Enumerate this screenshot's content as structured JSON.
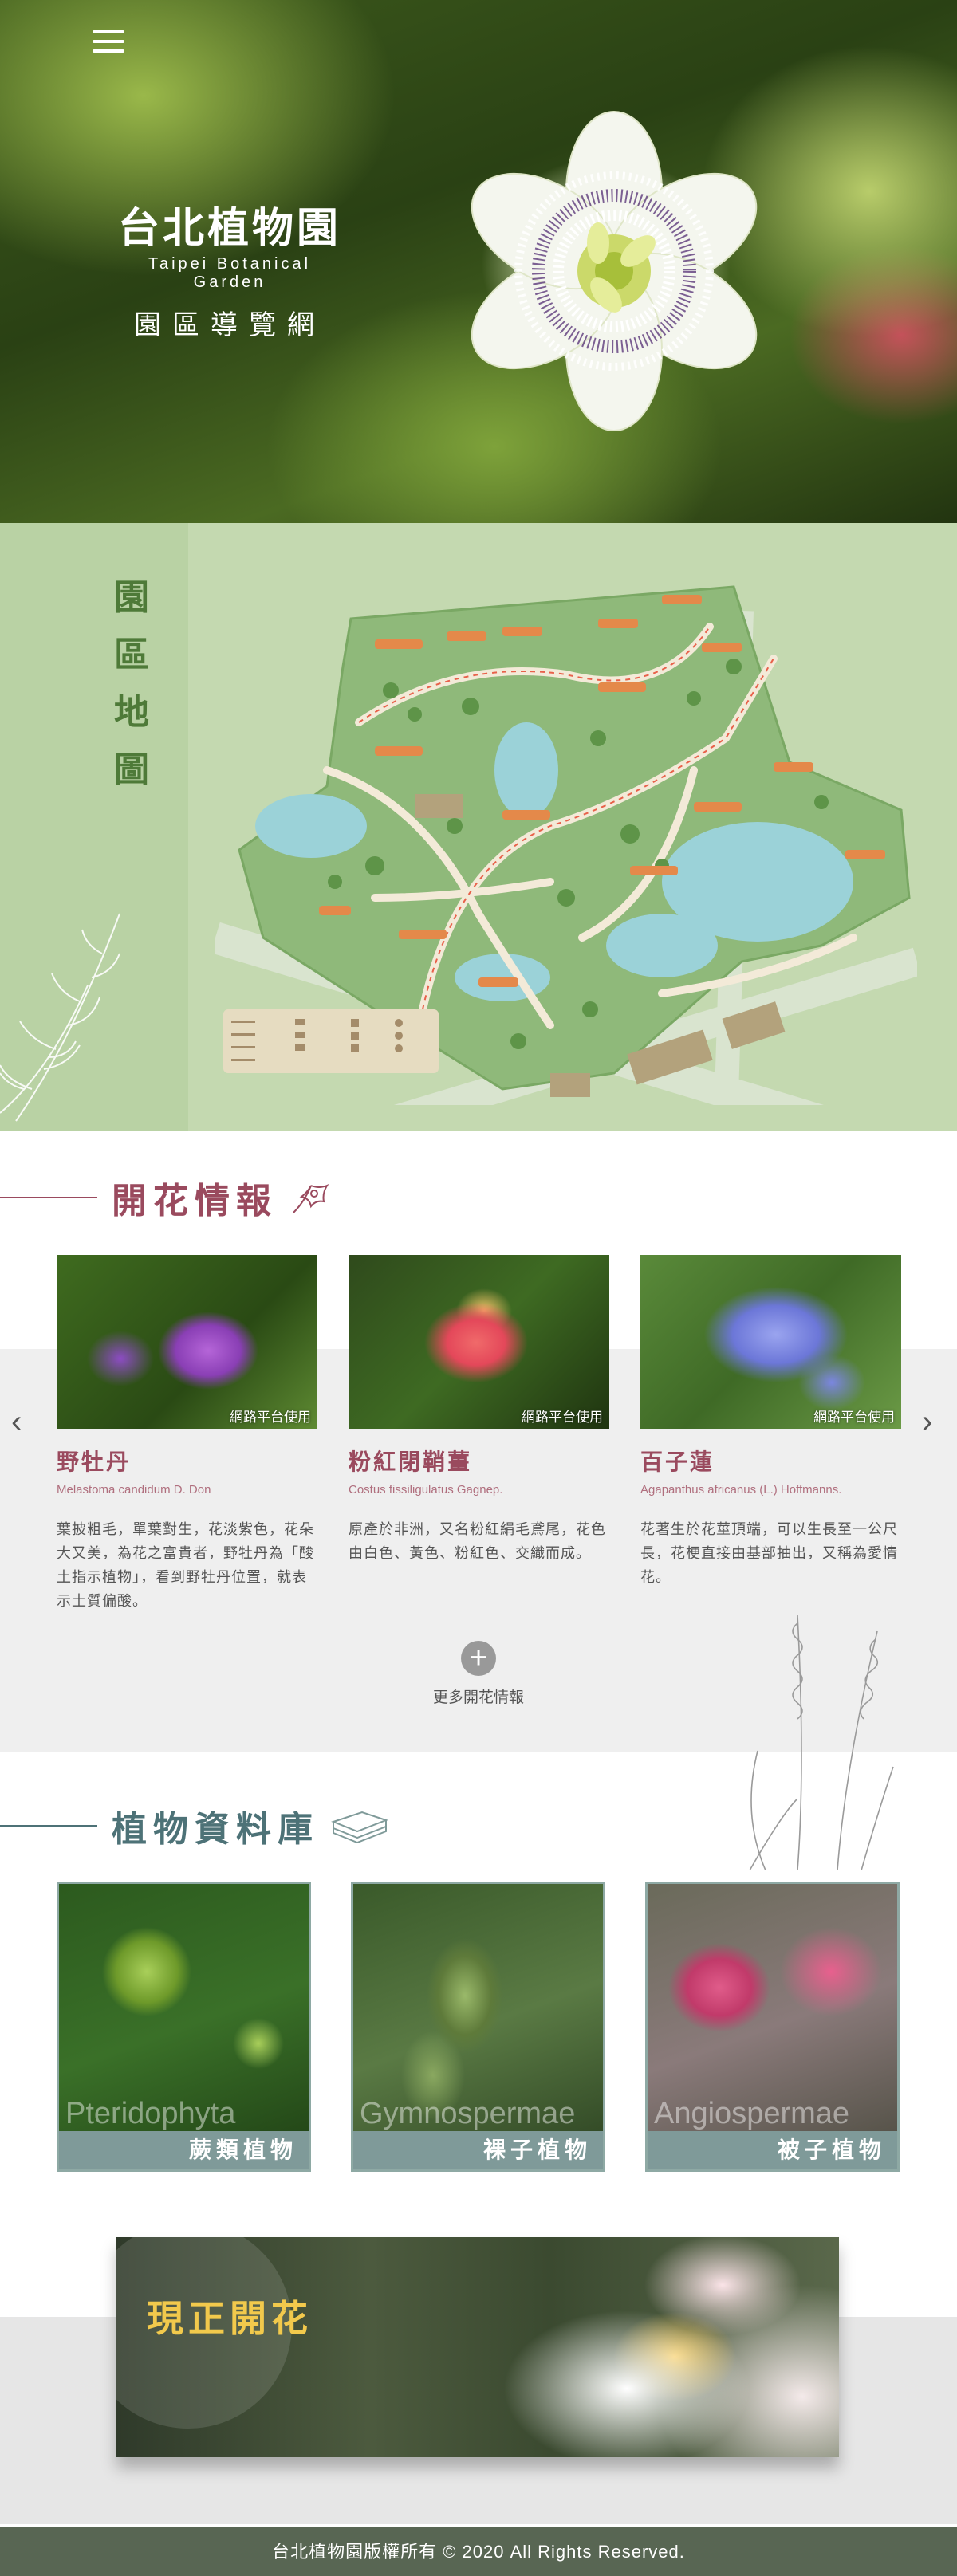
{
  "hero": {
    "logo_cn": "台北植物園",
    "logo_en": "Taipei Botanical Garden",
    "logo_sub": "園區導覽網"
  },
  "map": {
    "title_chars": [
      "園",
      "區",
      "地",
      "圖"
    ]
  },
  "flowers": {
    "title": "開花情報",
    "watermark": "網路平台使用",
    "items": [
      {
        "name": "野牡丹",
        "latin": "Melastoma candidum D. Don",
        "desc": "葉披粗毛，單葉對生，花淡紫色，花朵大又美，為花之富貴者，野牡丹為「酸土指示植物」，看到野牡丹位置，就表示土質偏酸。"
      },
      {
        "name": "粉紅閉鞘薑",
        "latin": "Costus fissiligulatus Gagnep.",
        "desc": "原產於非洲，又名粉紅絹毛鳶尾，花色由白色、黃色、粉紅色、交織而成。"
      },
      {
        "name": "百子蓮",
        "latin": "Agapanthus africanus (L.) Hoffmanns.",
        "desc": "花著生於花莖頂端，可以生長至一公尺長，花梗直接由基部抽出，又稱為愛情花。"
      }
    ],
    "more_icon": "+",
    "more_label": "更多開花情報",
    "prev_icon": "‹",
    "next_icon": "›"
  },
  "database": {
    "title": "植物資料庫",
    "items": [
      {
        "en": "Pteridophyta",
        "cn": "蕨類植物"
      },
      {
        "en": "Gymnospermae",
        "cn": "裸子植物"
      },
      {
        "en": "Angiospermae",
        "cn": "被子植物"
      }
    ]
  },
  "banner": {
    "label": "現正開花"
  },
  "footer": {
    "text": "台北植物園版權所有 © 2020 All Rights Reserved."
  },
  "colors": {
    "flower_title": "#9a4a5e",
    "db_title": "#4d7277",
    "map_green": "#4e7a38",
    "footer_bg": "#586653"
  }
}
